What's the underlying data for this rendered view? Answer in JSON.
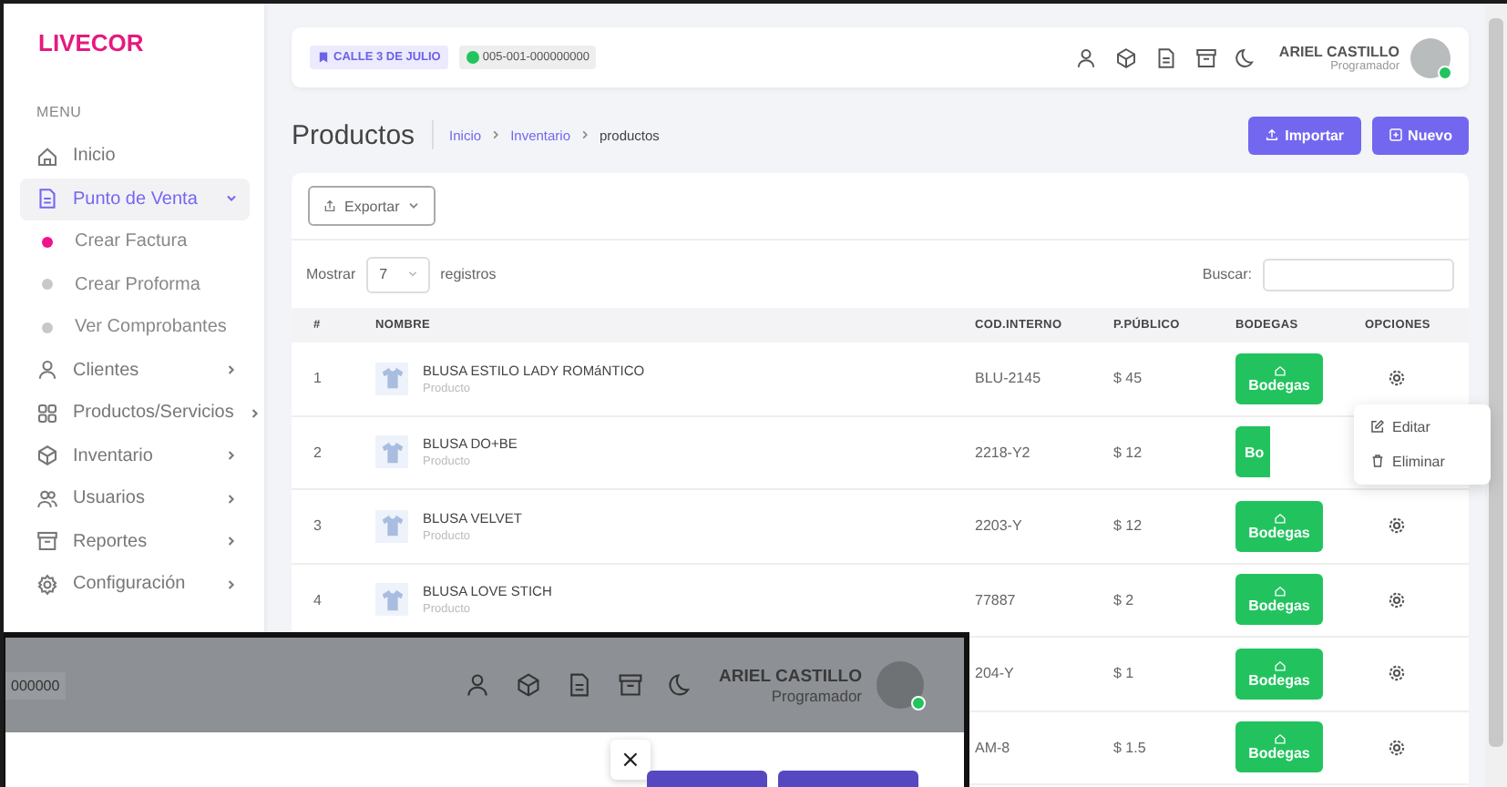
{
  "brand": "LIVECOR",
  "sidebar": {
    "heading": "MENU",
    "items": [
      {
        "label": "Inicio",
        "kind": "link",
        "selected": false
      },
      {
        "label": "Punto de Venta",
        "kind": "group",
        "selected": true,
        "expanded": true,
        "children": [
          {
            "label": "Crear Factura",
            "selected": true
          },
          {
            "label": "Crear Proforma",
            "selected": false
          },
          {
            "label": "Ver Comprobantes",
            "selected": false
          }
        ]
      },
      {
        "label": "Clientes",
        "kind": "group",
        "selected": false,
        "expanded": false
      },
      {
        "label": "Productos/Servicios",
        "kind": "group",
        "selected": false,
        "expanded": false
      },
      {
        "label": "Inventario",
        "kind": "group",
        "selected": false,
        "expanded": false
      },
      {
        "label": "Usuarios",
        "kind": "group",
        "selected": false,
        "expanded": false
      },
      {
        "label": "Reportes",
        "kind": "group",
        "selected": false,
        "expanded": false
      },
      {
        "label": "Configuración",
        "kind": "group",
        "selected": false,
        "expanded": false
      }
    ]
  },
  "header": {
    "location": "CALLE 3 DE JULIO",
    "point": "005-001-000000000",
    "user_name": "ARIEL CASTILLO",
    "user_role": "Programador",
    "online": true
  },
  "page": {
    "title": "Productos",
    "breadcrumb": [
      "Inicio",
      "Inventario",
      "productos"
    ],
    "buttons": [
      "Importar",
      "Nuevo"
    ]
  },
  "toolbar": {
    "export": "Exportar",
    "show_label": "Mostrar",
    "page_size": "7",
    "records_label": "registros",
    "search_label": "Buscar:"
  },
  "table": {
    "columns": [
      "#",
      "NOMBRE",
      "COD.INTERNO",
      "P.PÚBLICO",
      "BODEGAS",
      "OPCIONES"
    ],
    "rows": [
      {
        "number": "1",
        "name": "BLUSA ESTILO LADY ROMáNTICO",
        "type": "Producto",
        "code": "BLU-2145",
        "price": "$ 45",
        "bodegas": "Bodegas",
        "menu_open": false
      },
      {
        "number": "2",
        "name": "BLUSA DO+BE",
        "type": "Producto",
        "code": "2218-Y2",
        "price": "$ 12",
        "bodegas": "Bo",
        "menu_open": true
      },
      {
        "number": "3",
        "name": "BLUSA VELVET",
        "type": "Producto",
        "code": "2203-Y",
        "price": "$ 12",
        "bodegas": "Bodegas",
        "menu_open": false
      },
      {
        "number": "4",
        "name": "BLUSA LOVE STICH",
        "type": "Producto",
        "code": "77887",
        "price": "$ 2",
        "bodegas": "Bodegas",
        "menu_open": false
      },
      {
        "code": "204-Y",
        "price": "$ 1",
        "bodegas": "Bodegas",
        "menu_open": false
      },
      {
        "code": "AM-8",
        "price": "$ 1.5",
        "bodegas": "Bodegas",
        "menu_open": false
      }
    ]
  },
  "row_menu": {
    "items": [
      "Editar",
      "Eliminar"
    ]
  },
  "inset": {
    "point": "000000",
    "user_name": "ARIEL CASTILLO",
    "user_role": "Programador",
    "online": true,
    "close": "×"
  }
}
